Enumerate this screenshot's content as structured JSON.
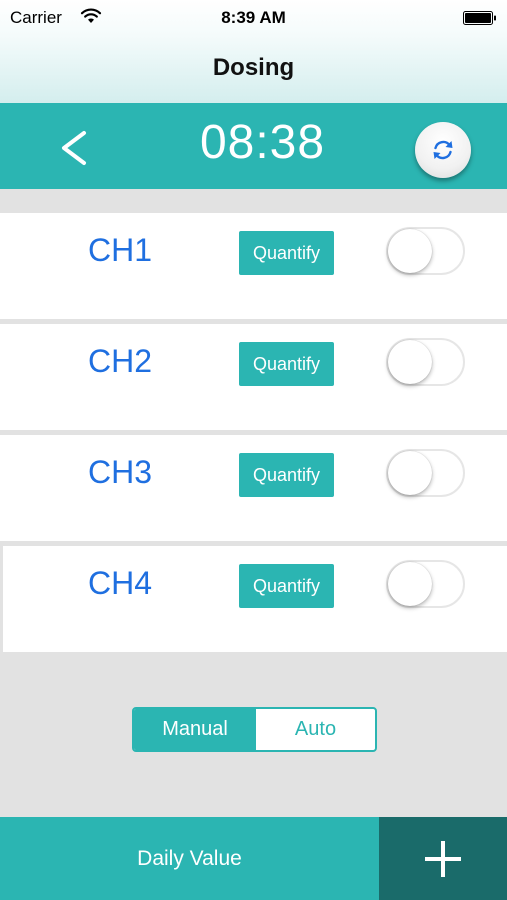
{
  "status_bar": {
    "carrier": "Carrier",
    "time": "8:39 AM"
  },
  "nav": {
    "title": "Dosing"
  },
  "header": {
    "back_label": "<",
    "clock": "08:38"
  },
  "channels": [
    {
      "label": "CH1",
      "button": "Quantify",
      "enabled": false
    },
    {
      "label": "CH2",
      "button": "Quantify",
      "enabled": false
    },
    {
      "label": "CH3",
      "button": "Quantify",
      "enabled": false
    },
    {
      "label": "CH4",
      "button": "Quantify",
      "enabled": false
    }
  ],
  "mode": {
    "options": [
      "Manual",
      "Auto"
    ],
    "selected": "Manual"
  },
  "bottom_bar": {
    "daily_value_label": "Daily Value"
  },
  "colors": {
    "accent": "#2bb5b2",
    "accent_dark": "#1a6b6a",
    "channel_label": "#1f6fe0",
    "background": "#e2e2e2"
  },
  "icons": {
    "wifi": "wifi-icon",
    "battery": "battery-icon",
    "refresh": "refresh-icon",
    "add": "plus-icon"
  }
}
